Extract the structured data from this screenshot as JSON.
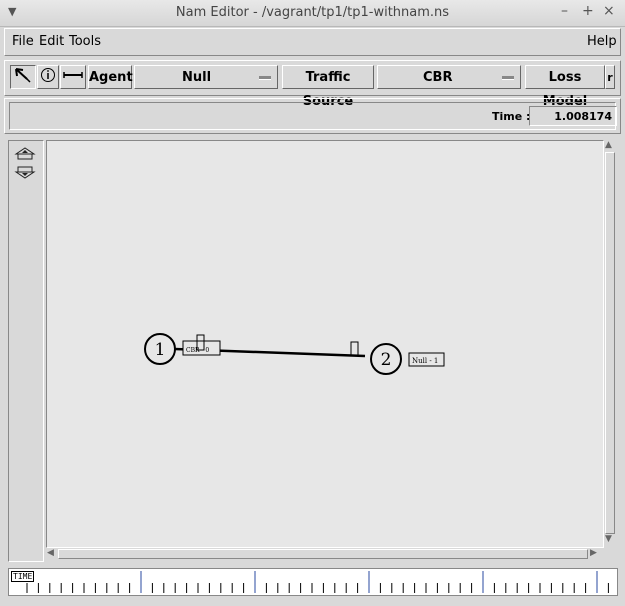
{
  "window": {
    "title": "Nam Editor - /vagrant/tp1/tp1-withnam.ns",
    "minimize": "–",
    "maximize": "+",
    "close": "×"
  },
  "menu": {
    "file": "File",
    "edit": "Edit",
    "tools": "Tools",
    "help": "Help"
  },
  "toolbar": {
    "agent_label": "Agent",
    "agent_value": "Null",
    "traffic_label": "Traffic Source",
    "traffic_value": "CBR",
    "loss_label": "Loss Model",
    "loss_overflow": "r"
  },
  "status": {
    "time_label": "Time :",
    "time_value": "1.008174"
  },
  "topology": {
    "nodes": [
      {
        "label": "1"
      },
      {
        "label": "2"
      }
    ],
    "agent_tag": "Null - 1",
    "source_tag": "CBR - 0"
  },
  "timeline": {
    "label": "TIME"
  },
  "colors": {
    "background": "#d9d9d9",
    "canvas": "#e7e7e7"
  },
  "icons": {
    "select": "pointer-arrow-icon",
    "info": "info-icon",
    "link": "link-tool-icon",
    "zoom_in": "zoom-in-icon",
    "zoom_out": "zoom-out-icon"
  }
}
